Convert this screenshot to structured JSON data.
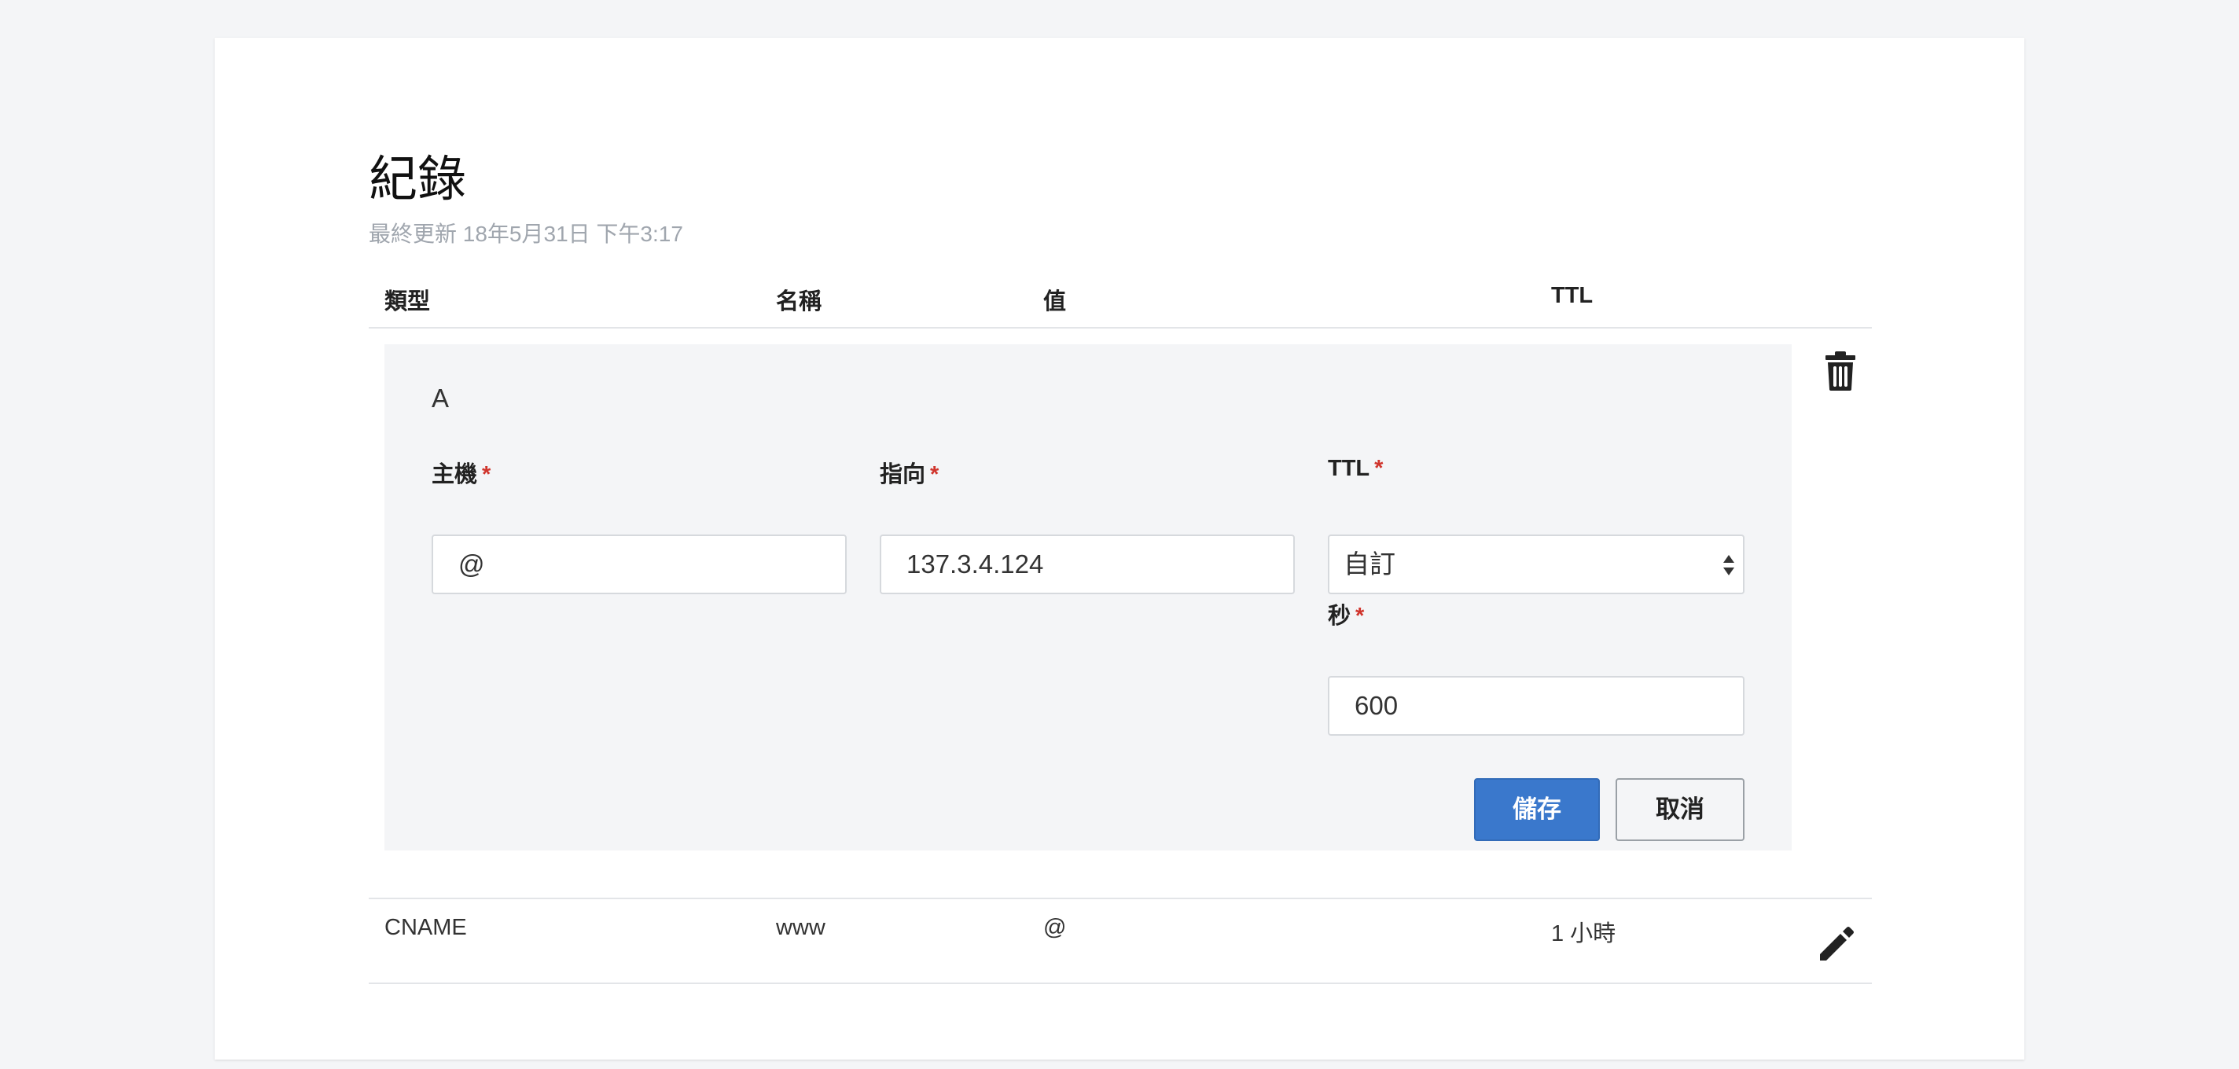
{
  "page": {
    "title": "紀錄",
    "last_updated": "最終更新 18年5月31日 下午3:17"
  },
  "table": {
    "headers": {
      "type": "類型",
      "name": "名稱",
      "value": "值",
      "ttl": "TTL"
    }
  },
  "edit_form": {
    "record_type": "A",
    "host_label": "主機",
    "host_value": "@",
    "points_to_label": "指向",
    "points_to_value": "137.3.4.124",
    "ttl_label": "TTL",
    "ttl_selected": "自訂",
    "seconds_label": "秒",
    "seconds_value": "600",
    "required_mark": "*",
    "save_label": "儲存",
    "cancel_label": "取消"
  },
  "rows": [
    {
      "type": "CNAME",
      "name": "www",
      "value": "@",
      "ttl": "1 小時"
    }
  ],
  "colors": {
    "primary": "#3a78cc",
    "required": "#d0342c",
    "panel_bg": "#f4f5f7"
  },
  "icons": {
    "delete": "trash-icon",
    "edit": "pencil-icon",
    "select": "sort-arrows-icon"
  }
}
